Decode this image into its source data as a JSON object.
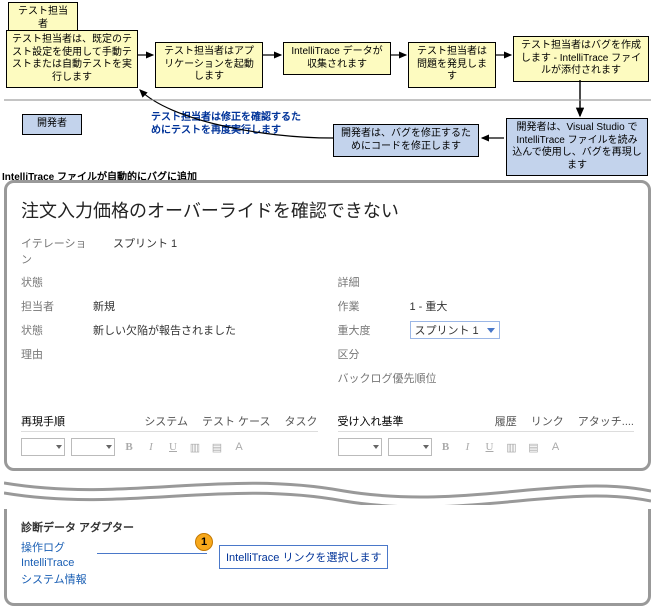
{
  "flow": {
    "tester_header": "テスト担当者",
    "dev_header": "開発者",
    "b1": "テスト担当者は、既定のテスト設定を使用して手動テストまたは自動テストを実行します",
    "b2": "テスト担当者はアプリケーションを起動します",
    "b3": "IntelliTrace データが収集されます",
    "b4": "テスト担当者は問題を発見します",
    "b5": "テスト担当者はバグを作成します - IntelliTrace ファイルが添付されます",
    "b6": "開発者は、Visual Studio で IntelliTrace ファイルを読み込んで使用し、バグを再現します",
    "b7": "開発者は、バグを修正するためにコードを修正します",
    "retest_note": "テスト担当者は修正を確認するためにテストを再度実行します",
    "auto_note": "IntelliTrace ファイルが自動的にバグに追加"
  },
  "form": {
    "title": "注文入力価格のオーバーライドを確認できない",
    "iteration_lbl": "イテレーション",
    "iteration_val": "スプリント 1",
    "left_header": "状態",
    "right_header": "詳細",
    "assigned_lbl": "担当者",
    "assigned_val": "新規",
    "state_lbl": "状態",
    "state_val": "新しい欠陥が報告されました",
    "reason_lbl": "理由",
    "work_lbl": "作業",
    "work_val": "1 - 重大",
    "severity_lbl": "重大度",
    "severity_val": "スプリント 1",
    "area_lbl": "区分",
    "backlog_lbl": "バックログ優先順位",
    "tabs_left": {
      "repro": "再現手順",
      "system": "システム",
      "testcases": "テスト ケース",
      "tasks": "タスク"
    },
    "tabs_right": {
      "accept": "受け入れ基準",
      "history": "履歴",
      "links": "リンク",
      "attach": "アタッチ...."
    }
  },
  "bottom": {
    "section": "診断データ アダプター",
    "links": {
      "oplog": "操作ログ",
      "intellitrace": "IntelliTrace",
      "sysinfo": "システム情報"
    },
    "callout_num": "1",
    "callout_text": "IntelliTrace リンクを選択します"
  }
}
